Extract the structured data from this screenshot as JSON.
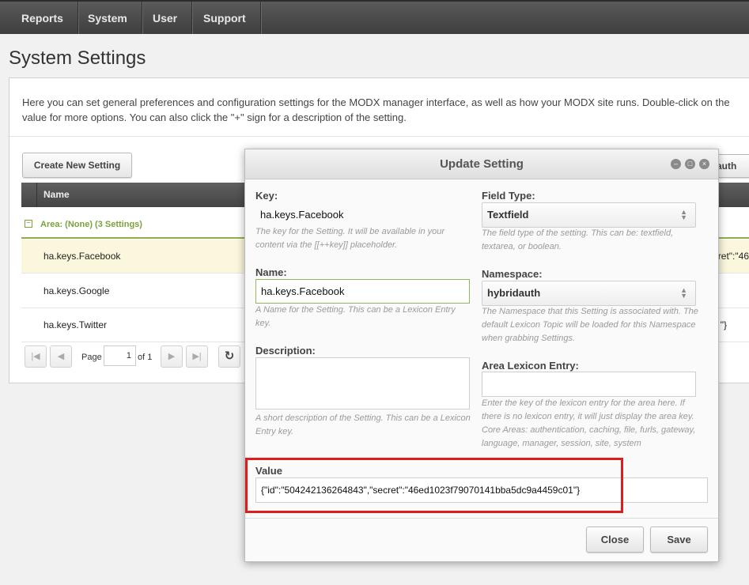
{
  "nav": {
    "items": [
      "Reports",
      "System",
      "User",
      "Support"
    ]
  },
  "page": {
    "title": "System Settings",
    "intro": "Here you can set general preferences and configuration settings for the MODX manager interface, as well as how your MODX site runs. Double-click on the value for more options. You can also click the \"+\" sign for a description of the setting."
  },
  "toolbar": {
    "create_label": "Create New Setting",
    "namespace_filter_partial": "auth"
  },
  "grid": {
    "column_name": "Name",
    "group_label": "Area: (None) (3 Settings)",
    "rows": [
      {
        "name": "ha.keys.Facebook",
        "value_partial": "cret\":\"46"
      },
      {
        "name": "ha.keys.Google",
        "value_partial": ""
      },
      {
        "name": "ha.keys.Twitter",
        "value_partial": "\"}"
      }
    ]
  },
  "pager": {
    "page_label": "Page",
    "page_value": "1",
    "of_label": "of 1"
  },
  "dialog": {
    "title": "Update Setting",
    "key_label": "Key:",
    "key_value": "ha.keys.Facebook",
    "key_help": "The key for the Setting. It will be available in your content via the [[++key]] placeholder.",
    "name_label": "Name:",
    "name_value": "ha.keys.Facebook",
    "name_help": "A Name for the Setting. This can be a Lexicon Entry key.",
    "description_label": "Description:",
    "description_value": "",
    "description_help": "A short description of the Setting. This can be a Lexicon Entry key.",
    "field_type_label": "Field Type:",
    "field_type_value": "Textfield",
    "field_type_help": "The field type of the setting. This can be: textfield, textarea, or boolean.",
    "namespace_label": "Namespace:",
    "namespace_value": "hybridauth",
    "namespace_help": "The Namespace that this Setting is associated with. The default Lexicon Topic will be loaded for this Namespace when grabbing Settings.",
    "area_label": "Area Lexicon Entry:",
    "area_value": "",
    "area_help": "Enter the key of the lexicon entry for the area here. If there is no lexicon entry, it will just display the area key. Core Areas: authentication, caching, file, furls, gateway, language, manager, session, site, system",
    "value_label": "Value",
    "value_value": "{\"id\":\"504242136264843\",\"secret\":\"46ed1023f79070141bba5dc9a4459c01\"}",
    "close_label": "Close",
    "save_label": "Save"
  },
  "colors": {
    "accent_green": "#7aa33b",
    "highlight_red": "#e01b1b",
    "selected_row": "#fbf7dc"
  },
  "icons": [
    "first-page-icon",
    "prev-page-icon",
    "next-page-icon",
    "last-page-icon",
    "refresh-icon",
    "minimize-icon",
    "maximize-icon",
    "close-icon",
    "collapse-icon",
    "select-arrows-icon"
  ]
}
